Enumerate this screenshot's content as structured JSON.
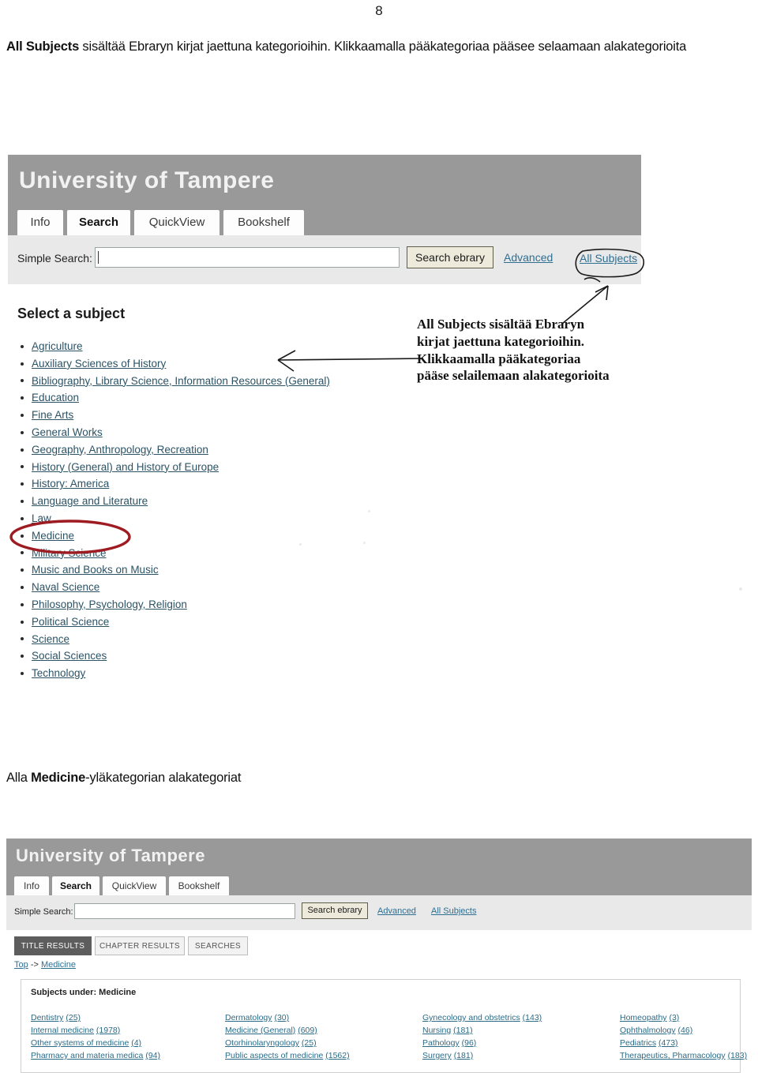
{
  "page": {
    "number": "8"
  },
  "intro": {
    "bold_lead": "All Subjects",
    "rest": " sisältää Ebraryn kirjat jaettuna kategorioihin. Klikkaamalla pääkategoriaa pääsee selaamaan alakategorioita"
  },
  "mid_caption": {
    "prefix": "Alla ",
    "bold": "Medicine",
    "suffix": "-yläkategorian alakategoriat"
  },
  "screenshot_top": {
    "brand_title": "University of Tampere",
    "tabs": [
      {
        "label": "Info",
        "active": false
      },
      {
        "label": "Search",
        "active": true
      },
      {
        "label": "QuickView",
        "active": false
      },
      {
        "label": "Bookshelf",
        "active": false
      }
    ],
    "search": {
      "label": "Simple Search:",
      "value": "",
      "placeholder": "",
      "button_label": "Search ebrary",
      "advanced_link": "Advanced",
      "all_subjects_link": "All Subjects"
    },
    "section_heading": "Select a subject",
    "subjects": [
      "Agriculture",
      "Auxiliary Sciences of History",
      "Bibliography, Library Science, Information Resources (General)",
      "Education",
      "Fine Arts",
      "General Works",
      "Geography, Anthropology, Recreation",
      "History (General) and History of Europe",
      "History: America",
      "Language and Literature",
      "Law",
      "Medicine",
      "Military Science",
      "Music and Books on Music",
      "Naval Science",
      "Philosophy, Psychology, Religion",
      "Political Science",
      "Science",
      "Social Sciences",
      "Technology"
    ],
    "highlighted_subject": "Medicine"
  },
  "annotation": {
    "lines": [
      "All Subjects sisältää Ebraryn",
      "kirjat jaettuna kategorioihin.",
      "Klikkaamalla pääkategoriaa",
      "pääse selailemaan alakategorioita"
    ],
    "ink_color": "#111111",
    "highlight_color": "#9e1b22"
  },
  "screenshot_bottom": {
    "brand_title": "University of Tampere",
    "tabs": [
      {
        "label": "Info",
        "active": false
      },
      {
        "label": "Search",
        "active": true
      },
      {
        "label": "QuickView",
        "active": false
      },
      {
        "label": "Bookshelf",
        "active": false
      }
    ],
    "search": {
      "label": "Simple Search:",
      "value": "",
      "placeholder": "",
      "button_label": "Search ebrary",
      "advanced_link": "Advanced",
      "all_subjects_link": "All Subjects"
    },
    "result_tabs": [
      {
        "label": "TITLE RESULTS",
        "active": true
      },
      {
        "label": "CHAPTER RESULTS",
        "active": false
      },
      {
        "label": "SEARCHES",
        "active": false
      }
    ],
    "breadcrumb": {
      "root": "Top",
      "separator": "->",
      "current": "Medicine"
    },
    "panel_title": "Subjects under: Medicine",
    "subject_columns": [
      [
        {
          "name": "Dentistry",
          "count": "(25)"
        },
        {
          "name": "Internal medicine",
          "count": "(1978)"
        },
        {
          "name": "Other systems of medicine",
          "count": "(4)"
        },
        {
          "name": "Pharmacy and materia medica",
          "count": "(94)"
        }
      ],
      [
        {
          "name": "Dermatology",
          "count": "(30)"
        },
        {
          "name": "Medicine (General)",
          "count": "(609)"
        },
        {
          "name": "Otorhinolaryngology",
          "count": "(25)"
        },
        {
          "name": "Public aspects of medicine",
          "count": "(1562)"
        }
      ],
      [
        {
          "name": "Gynecology and obstetrics",
          "count": "(143)"
        },
        {
          "name": "Nursing",
          "count": "(181)"
        },
        {
          "name": "Pathology",
          "count": "(96)"
        },
        {
          "name": "Surgery",
          "count": "(181)"
        }
      ],
      [
        {
          "name": "Homeopathy",
          "count": "(3)"
        },
        {
          "name": "Ophthalmology",
          "count": "(46)"
        },
        {
          "name": "Pediatrics",
          "count": "(473)"
        },
        {
          "name": "Therapeutics, Pharmacology",
          "count": "(183)"
        }
      ]
    ]
  }
}
